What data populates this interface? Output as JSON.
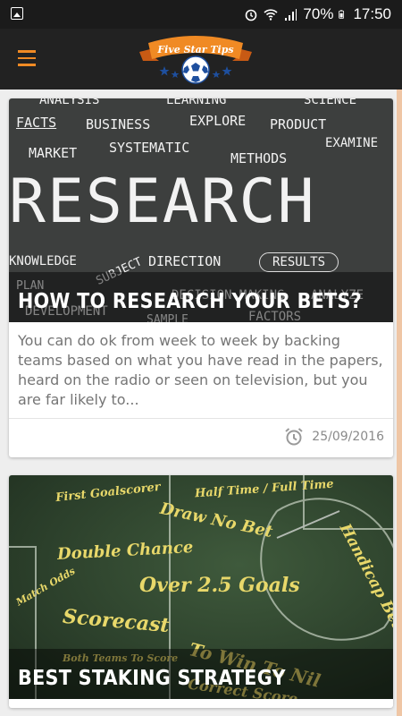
{
  "status_bar": {
    "battery_percent": "70%",
    "time": "17:50"
  },
  "app_bar": {
    "logo_text": "Five Star Tips",
    "menu_icon": "hamburger-menu-icon"
  },
  "articles": [
    {
      "title": "HOW TO RESEARCH YOUR BETS?",
      "excerpt": "You can do ok from week to week by backing teams based on what you have read in the papers, heard on the radio or seen on television, but you are far likely to...",
      "date": "25/09/2016",
      "image_words": [
        "ANALYSIS",
        "LEARNING",
        "SCIENCE",
        "FACTS",
        "BUSINESS",
        "EXPLORE",
        "PRODUCT",
        "MARKET",
        "SYSTEMATIC",
        "EXAMINE",
        "METHODS",
        "RESEARCH",
        "KNOWLEDGE",
        "SUBJECT",
        "DIRECTION",
        "RESULTS",
        "PLAN",
        "DEVELOPMENT",
        "DECISION MAKING",
        "ANALYZE",
        "SAMPLE",
        "FACTORS"
      ]
    },
    {
      "title": "BEST STAKING STRATEGY",
      "image_words": [
        "First Goalscorer",
        "Half Time / Full Time",
        "Draw No Bet",
        "Double Chance",
        "Over 2.5 Goals",
        "Handicap Betting",
        "Match Odds",
        "Scorecast",
        "To Win To Nil",
        "Both Teams To Score",
        "Correct Score"
      ]
    }
  ],
  "colors": {
    "accent": "#f08a24",
    "appbar": "#222222",
    "statusbar": "#1b1b1b"
  }
}
